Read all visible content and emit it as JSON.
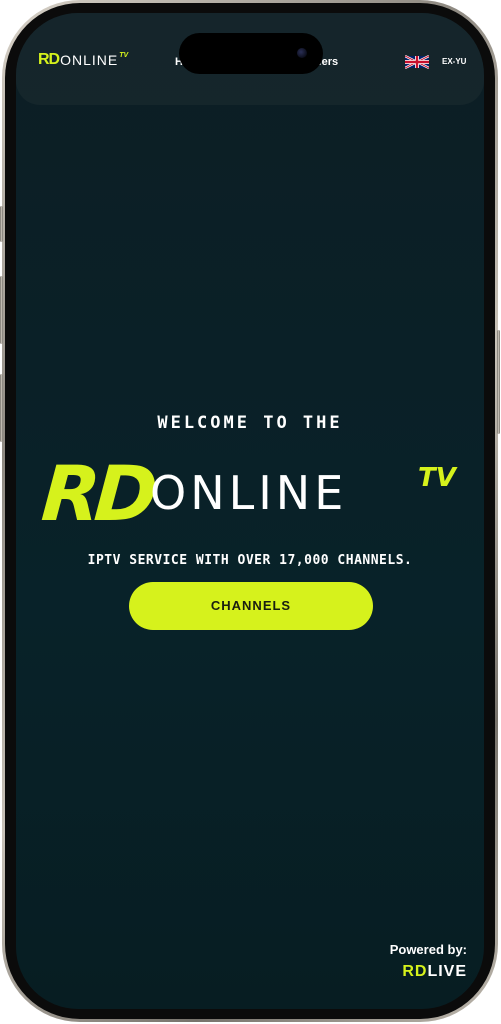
{
  "nav": {
    "logo_rd": "RD",
    "logo_online": "ONLINE",
    "logo_tv": "TV",
    "link_left": "H",
    "link_right": "fers",
    "language_code": "EX-YU",
    "flag_icon": "uk-flag-icon"
  },
  "hero": {
    "welcome_text": "WELCOME TO THE",
    "logo_rd": "RD",
    "logo_online": "ONLINE",
    "logo_tv": "TV",
    "tagline": "IPTV SERVICE WITH OVER 17,000 CHANNELS.",
    "channels_button": "CHANNELS"
  },
  "footer": {
    "powered_label": "Powered by:",
    "brand_rd": "RD",
    "brand_live": "LIVE"
  },
  "colors": {
    "accent": "#d6f21c",
    "background": "#0a2027",
    "text": "#ffffff"
  }
}
